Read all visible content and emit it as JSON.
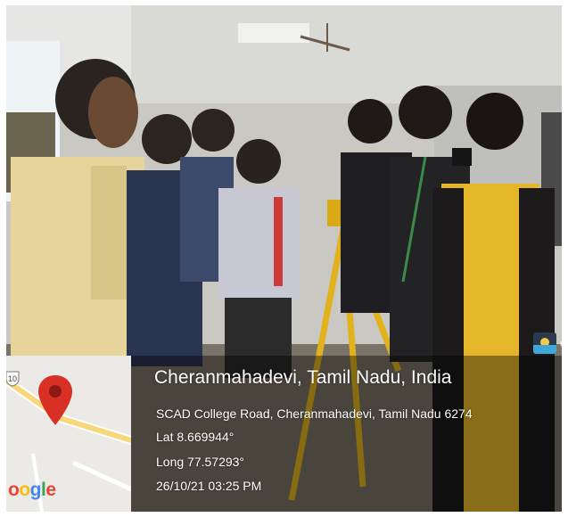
{
  "geotag": {
    "place_title": "Cheranmahadevi, Tamil Nadu, India",
    "address": "SCAD College Road, Cheranmahadevi, Tamil Nadu 6274",
    "latitude": "Lat 8.669944°",
    "longitude": "Long 77.57293°",
    "datetime": "26/10/21 03:25 PM",
    "badge_text": "o",
    "map_route_number": "10",
    "map_brand": {
      "part1": "o",
      "part2": "o",
      "part3": "g",
      "part4": "l",
      "part5": "e"
    }
  },
  "colors": {
    "pin": "#d93025",
    "road": "#f6d77a",
    "map_bg": "#eceae6",
    "overlay": "rgba(0,0,0,0.40)"
  },
  "icons": [
    "map-pin-icon",
    "route-shield-icon",
    "gps-camera-app-icon"
  ]
}
